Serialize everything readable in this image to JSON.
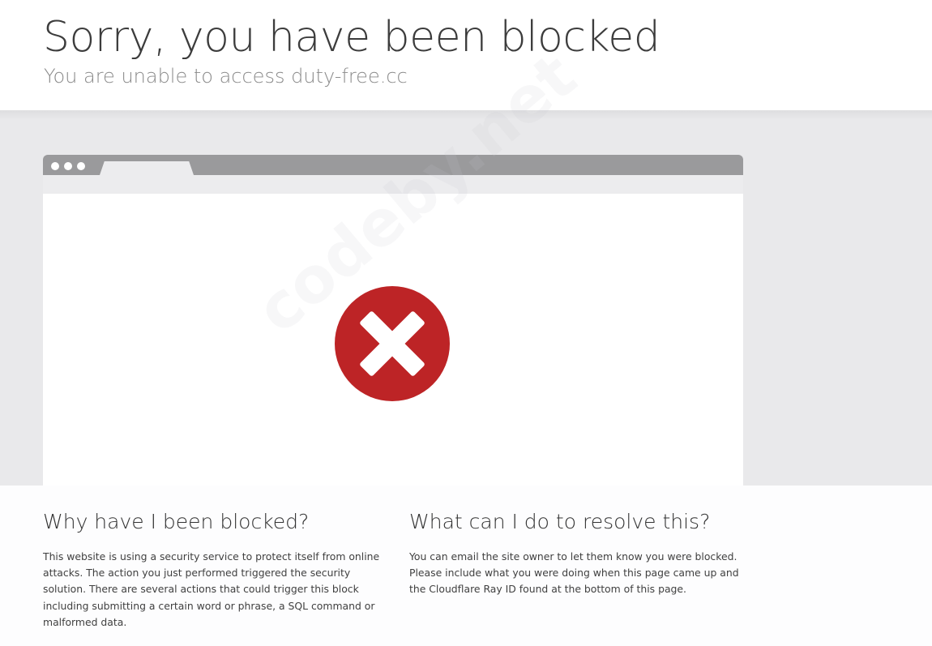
{
  "header": {
    "title": "Sorry, you have been blocked",
    "subtitle": "You are unable to access duty-free.cc"
  },
  "browser_illustration": {
    "icon": "error-x-icon",
    "icon_color": "#bd2426"
  },
  "watermark": {
    "text": "codeby.net"
  },
  "why_blocked": {
    "heading": "Why have I been blocked?",
    "body": "This website is using a security service to protect itself from online attacks. The action you just performed triggered the security solution. There are several actions that could trigger this block including submitting a certain word or phrase, a SQL command or malformed data."
  },
  "resolve": {
    "heading": "What can I do to resolve this?",
    "body": "You can email the site owner to let them know you were blocked. Please include what you were doing when this page came up and the Cloudflare Ray ID found at the bottom of this page."
  }
}
